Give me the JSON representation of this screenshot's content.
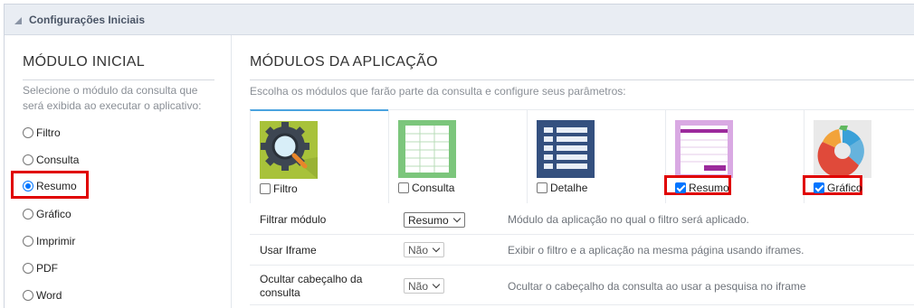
{
  "section": {
    "title": "Configurações Iniciais"
  },
  "initial_module": {
    "title": "MÓDULO INICIAL",
    "description": "Selecione o módulo da consulta que será exibida ao executar o aplicativo:",
    "options": [
      {
        "label": "Filtro",
        "selected": false
      },
      {
        "label": "Consulta",
        "selected": false
      },
      {
        "label": "Resumo",
        "selected": true
      },
      {
        "label": "Gráfico",
        "selected": false
      },
      {
        "label": "Imprimir",
        "selected": false
      },
      {
        "label": "PDF",
        "selected": false
      },
      {
        "label": "Word",
        "selected": false
      }
    ]
  },
  "app_modules": {
    "title": "MÓDULOS DA APLICAÇÃO",
    "description": "Escolha os módulos que farão parte da consulta e configure seus parâmetros:",
    "modules": [
      {
        "label": "Filtro",
        "checked": false,
        "icon": "filter-magnifier-icon"
      },
      {
        "label": "Consulta",
        "checked": false,
        "icon": "grid-table-icon"
      },
      {
        "label": "Detalhe",
        "checked": false,
        "icon": "detail-list-icon"
      },
      {
        "label": "Resumo",
        "checked": true,
        "icon": "summary-table-icon"
      },
      {
        "label": "Gráfico",
        "checked": true,
        "icon": "pie-chart-icon"
      }
    ]
  },
  "params": [
    {
      "label": "Filtrar módulo",
      "value": "Resumo",
      "description": "Módulo da aplicação no qual o filtro será aplicado."
    },
    {
      "label": "Usar Iframe",
      "value": "Não",
      "description": "Exibir o filtro e a aplicação na mesma página usando iframes."
    },
    {
      "label": "Ocultar cabeçalho da consulta",
      "value": "Não",
      "description": "Ocultar o cabeçalho da consulta ao usar a pesquisa no iframe"
    }
  ],
  "colors": {
    "highlight": "#e00000",
    "accent": "#0075ff",
    "header_bg": "#e9edf3"
  }
}
